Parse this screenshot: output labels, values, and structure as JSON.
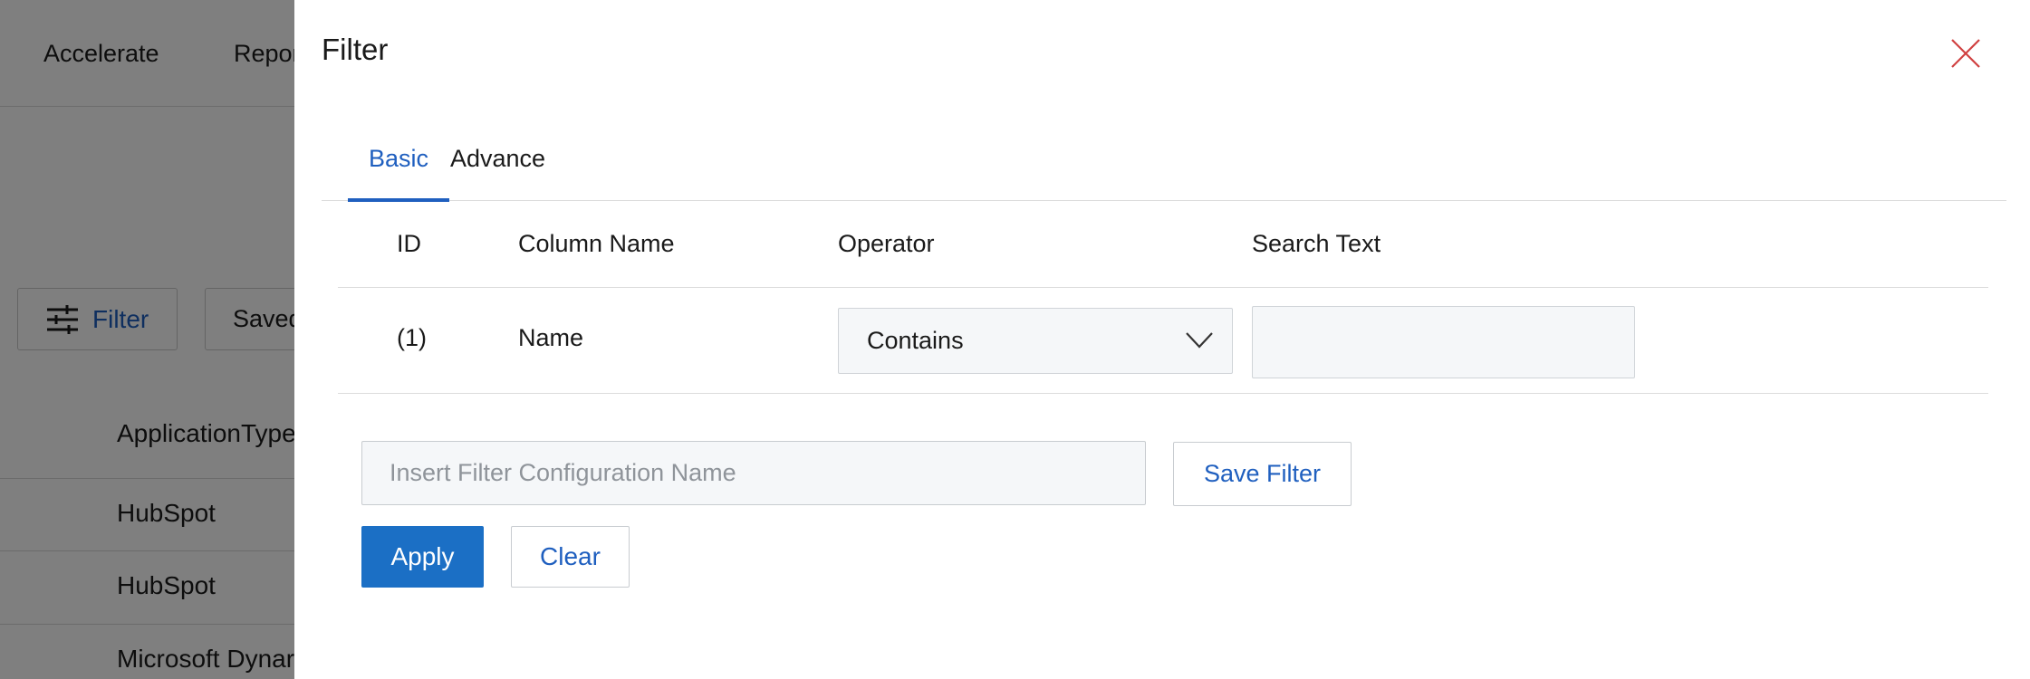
{
  "background": {
    "nav": [
      "Accelerate",
      "Repor"
    ],
    "filter_button_label": "Filter",
    "saved_button_label": "Saved",
    "table_header": "ApplicationType",
    "rows": [
      "HubSpot",
      "HubSpot",
      "Microsoft Dynar"
    ]
  },
  "panel": {
    "title": "Filter",
    "close_icon": "close-icon",
    "tabs": [
      {
        "label": "Basic",
        "active": true
      },
      {
        "label": "Advance",
        "active": false
      }
    ],
    "columns": {
      "id": "ID",
      "column_name": "Column Name",
      "operator": "Operator",
      "search_text": "Search Text"
    },
    "rows": [
      {
        "id": "(1)",
        "column_name": "Name",
        "operator": "Contains",
        "search_text": ""
      }
    ],
    "config_name_placeholder": "Insert Filter Configuration Name",
    "save_filter_label": "Save Filter",
    "apply_label": "Apply",
    "clear_label": "Clear"
  },
  "colors": {
    "accent": "#1f5fbf",
    "primary_button": "#1b6fc5",
    "close_icon": "#d04040",
    "overlay": "rgba(0,0,0,0.5)"
  }
}
